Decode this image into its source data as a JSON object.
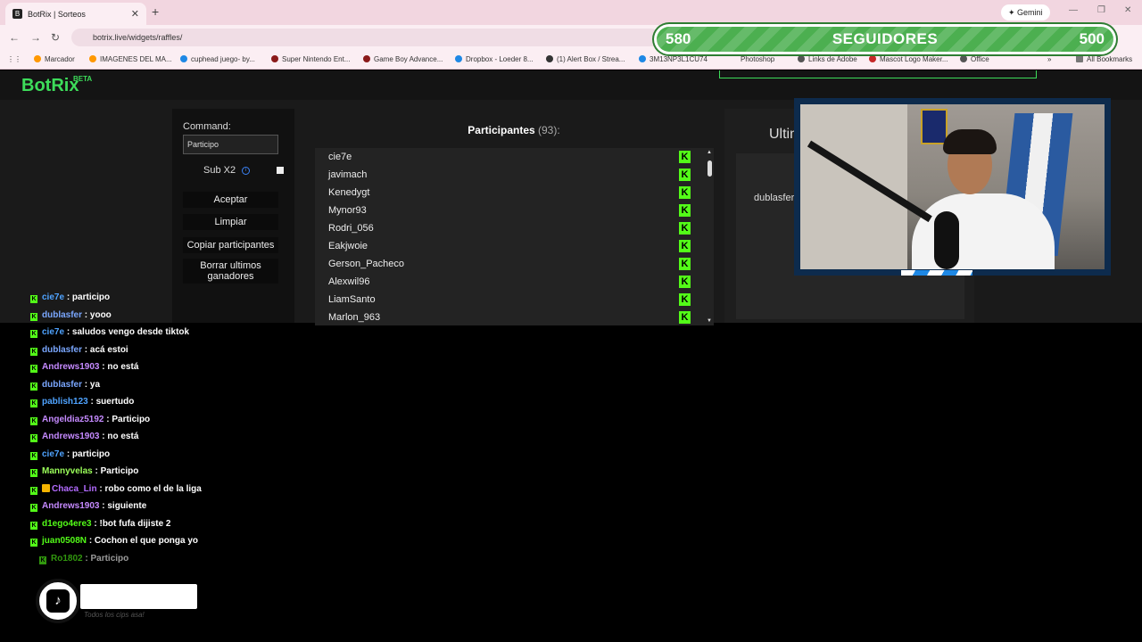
{
  "browser": {
    "tab_title": "BotRix | Sorteos",
    "gemini_label": "Gemini",
    "url": "botrix.live/widgets/raffles/",
    "bookmarks": [
      "Marcador",
      "IMAGENES DEL MA...",
      "cuphead juego- by...",
      "Super Nintendo Ent...",
      "Game Boy Advance...",
      "Dropbox - Loeder 8...",
      "(1) Alert Box / Strea...",
      "3M13NP3L1CU74",
      "Photoshop",
      "Links de Adobe",
      "Mascot Logo Maker...",
      "Office"
    ],
    "all_bookmarks": "All Bookmarks"
  },
  "followers_bar": {
    "current": "580",
    "label": "SEGUIDORES",
    "goal": "500",
    "colors": {
      "fill": "#4caf50",
      "stripe": "#66bb6a"
    }
  },
  "app": {
    "logo": "BotRix",
    "beta": "BETA",
    "accent": "#3ddc5a"
  },
  "raffle": {
    "command_label": "Command:",
    "command_value": "Participo",
    "sub_label": "Sub X2",
    "buttons": {
      "accept": "Aceptar",
      "clear": "Limpiar",
      "copy": "Copiar participantes",
      "delete_winners": "Borrar ultimos ganadores"
    },
    "participants_title": "Participantes",
    "participants_count": "(93):",
    "participants": [
      "cie7e",
      "javimach",
      "Kenedygt",
      "Mynor93",
      "Rodri_056",
      "Eakjwoie",
      "Gerson_Pacheco",
      "Alexwil96",
      "LiamSanto",
      "Marlon_963"
    ],
    "winners_title": "Ultim",
    "winners": [
      "dublasfer"
    ]
  },
  "chat": [
    {
      "user": "cie7e",
      "color": "#4fa3ff",
      "text": ": participo",
      "faded": false
    },
    {
      "user": "dublasfer",
      "color": "#7aa7ff",
      "text": ": yooo",
      "faded": false
    },
    {
      "user": "cie7e",
      "color": "#4fa3ff",
      "text": ": saludos vengo desde tiktok",
      "faded": false
    },
    {
      "user": "dublasfer",
      "color": "#7aa7ff",
      "text": ": acá estoi",
      "faded": false
    },
    {
      "user": "Andrews1903",
      "color": "#c58aff",
      "text": ": no está",
      "faded": false
    },
    {
      "user": "dublasfer",
      "color": "#7aa7ff",
      "text": ": ya",
      "faded": false
    },
    {
      "user": "pablish123",
      "color": "#4fa3ff",
      "text": ": suertudo",
      "faded": false
    },
    {
      "user": "Angeldiaz5192",
      "color": "#c58aff",
      "text": ": Participo",
      "faded": false
    },
    {
      "user": "Andrews1903",
      "color": "#c58aff",
      "text": ": no está",
      "faded": false
    },
    {
      "user": "cie7e",
      "color": "#4fa3ff",
      "text": ": participo",
      "faded": false
    },
    {
      "user": "Mannyvelas",
      "color": "#9cff5a",
      "text": ": Participo",
      "faded": false
    },
    {
      "user": "Chaca_Lin",
      "color": "#b36bff",
      "text": ": robo como el de la liga",
      "faded": false,
      "badge": true
    },
    {
      "user": "Andrews1903",
      "color": "#c58aff",
      "text": ": siguiente",
      "faded": false
    },
    {
      "user": "d1ego4ere3",
      "color": "#53fc18",
      "text": ": !bot fufa dijiste 2",
      "faded": false
    },
    {
      "user": "juan0508N",
      "color": "#53fc18",
      "text": ": Cochon el que ponga yo",
      "faded": false
    },
    {
      "user": "Ro1802",
      "color": "#53fc18",
      "text": ": Participo",
      "faded": true
    }
  ],
  "tiktok": {
    "label": "Todos los cips asa!"
  }
}
